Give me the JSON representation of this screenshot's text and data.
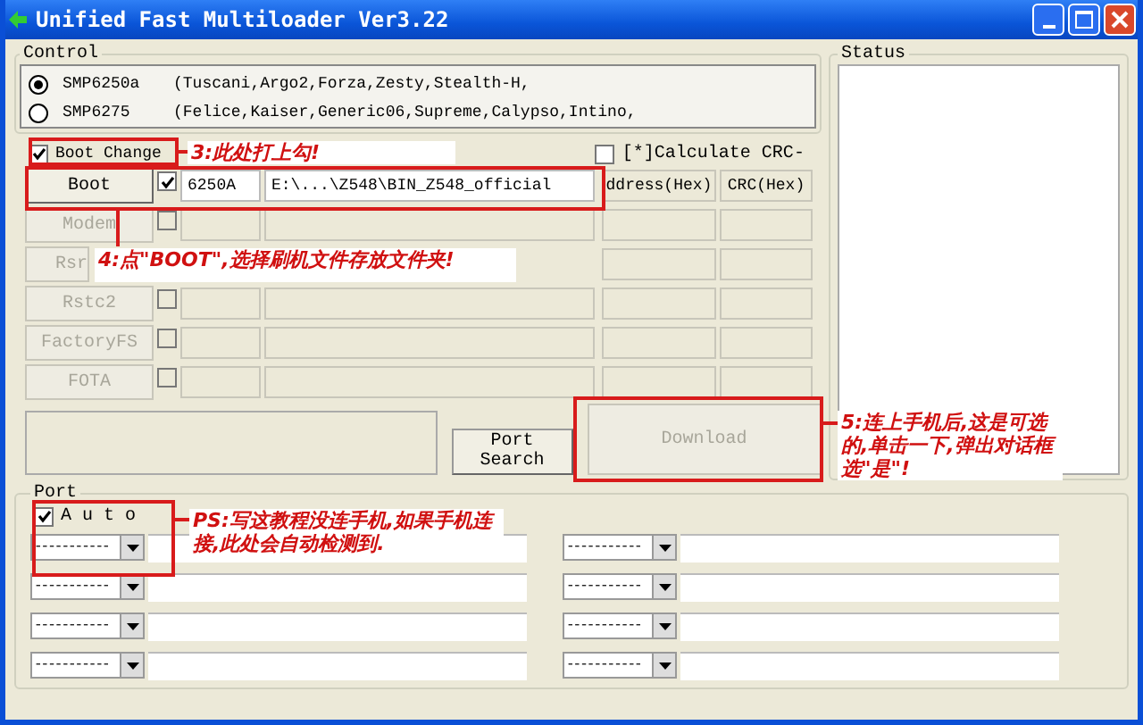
{
  "window": {
    "title": "Unified Fast Multiloader Ver3.22"
  },
  "control": {
    "label": "Control",
    "options": [
      {
        "label": "SMP6250a",
        "description": "(Tuscani,Argo2,Forza,Zesty,Stealth-H,",
        "selected": true
      },
      {
        "label": "SMP6275",
        "description": "(Felice,Kaiser,Generic06,Supreme,Calypso,Intino,",
        "selected": false
      }
    ]
  },
  "boot_change": {
    "label": "Boot Change",
    "checked": true
  },
  "calculate_crc": {
    "label": "[*]Calculate CRC-",
    "checked": false
  },
  "columns": [
    "ddress(Hex)",
    "CRC(Hex)"
  ],
  "files": [
    {
      "button": "Boot",
      "disabled": false,
      "checked": true,
      "type": "6250A",
      "path": "E:\\...\\Z548\\BIN_Z548_official"
    },
    {
      "button": "Modem",
      "disabled": true,
      "checked": false
    },
    {
      "button": "Rsr",
      "disabled": true
    },
    {
      "button": "Rstc2",
      "disabled": true,
      "checked": false
    },
    {
      "button": "FactoryFS",
      "disabled": true,
      "checked": false
    },
    {
      "button": "FOTA",
      "disabled": true,
      "checked": false
    }
  ],
  "port_search": {
    "label": "Port Search"
  },
  "download": {
    "label": "Download",
    "disabled": true
  },
  "status": {
    "label": "Status"
  },
  "port": {
    "label": "Port",
    "auto": {
      "label": "A u t o",
      "checked": true
    },
    "slots": [
      {
        "value": "-----------"
      },
      {
        "value": "-----------"
      },
      {
        "value": "-----------"
      },
      {
        "value": "-----------"
      },
      {
        "value": "-----------"
      },
      {
        "value": "-----------"
      },
      {
        "value": "-----------"
      },
      {
        "value": "-----------"
      }
    ]
  },
  "annotations": [
    {
      "text": "3:此处打上勾!"
    },
    {
      "text": "4:点\"BOOT\",选择刷机文件存放文件夹!"
    },
    {
      "text": "5:连上手机后,这是可选的,单击一下,弹出对话框选\"是\"!"
    },
    {
      "text": "PS:写这教程没连手机,如果手机连接,此处会自动检测到."
    }
  ]
}
